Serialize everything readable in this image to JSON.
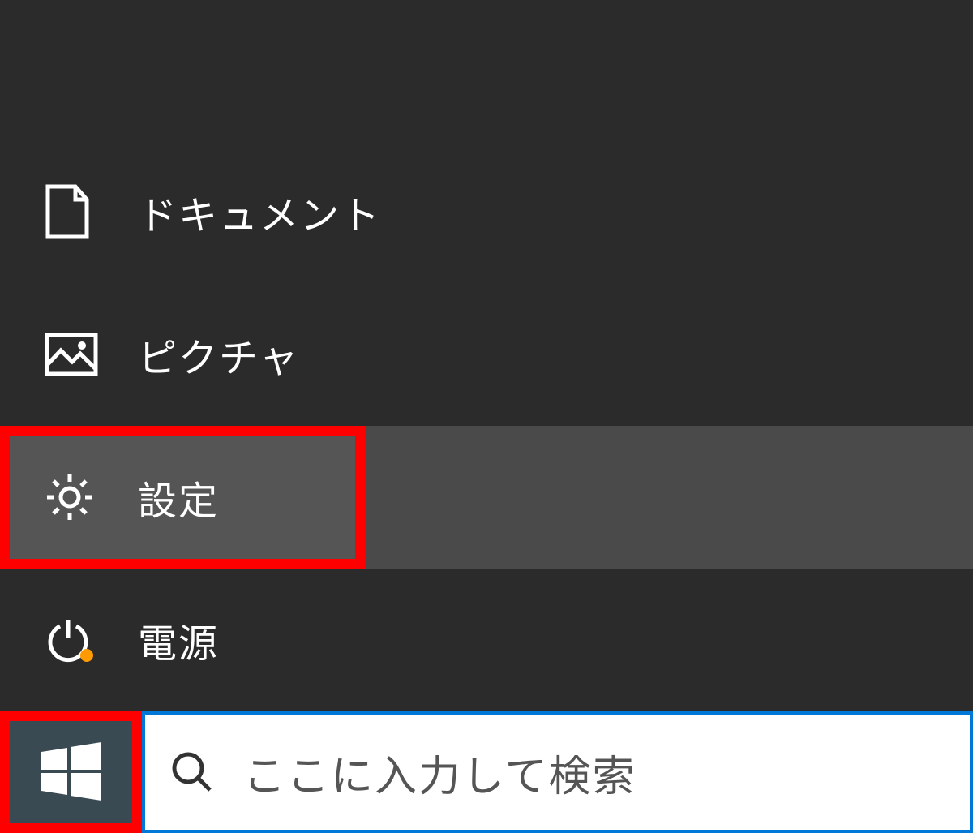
{
  "menu": {
    "documents": {
      "label": "ドキュメント"
    },
    "pictures": {
      "label": "ピクチャ"
    },
    "settings": {
      "label": "設定"
    },
    "power": {
      "label": "電源"
    }
  },
  "search": {
    "placeholder": "ここに入力して検索"
  },
  "colors": {
    "highlight_red": "#ff0000",
    "search_border": "#0078d7",
    "power_dot": "#ff9a00"
  }
}
